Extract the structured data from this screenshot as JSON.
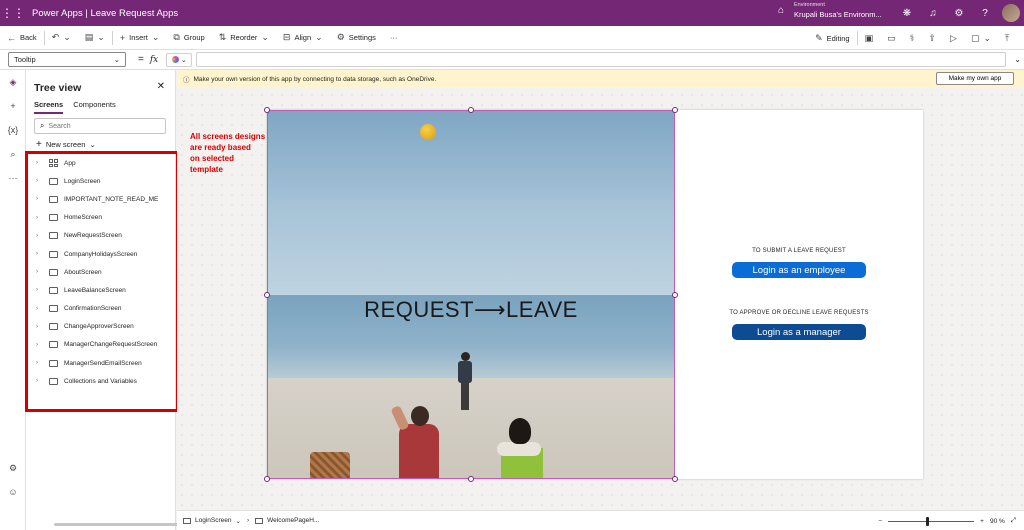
{
  "header": {
    "app_name": "Power Apps",
    "separator": "|",
    "app_title": "Leave Request Apps",
    "env_label": "Environment",
    "env_name": "Krupali Busa's Environm..."
  },
  "toolbar": {
    "back": "Back",
    "insert": "Insert",
    "group": "Group",
    "reorder": "Reorder",
    "align": "Align",
    "settings": "Settings",
    "more": "···",
    "editing": "Editing"
  },
  "formula": {
    "property": "Tooltip",
    "eq": "=",
    "fx": "fx"
  },
  "tree": {
    "title": "Tree view",
    "tabs": [
      "Screens",
      "Components"
    ],
    "search_placeholder": "Search",
    "new_screen": "New screen",
    "items": [
      "App",
      "LoginScreen",
      "IMPORTANT_NOTE_READ_ME",
      "HomeScreen",
      "NewRequestScreen",
      "CompanyHolidaysScreen",
      "AboutScreen",
      "LeaveBalanceScreen",
      "ConfirmationScreen",
      "ChangeApproverScreen",
      "ManagerChangeRequestScreen",
      "ManagerSendEmailScreen",
      "Collections and Variables"
    ]
  },
  "notice": {
    "text": "Make your own version of this app by connecting to data storage, such as OneDrive.",
    "button": "Make my own app"
  },
  "annotation": {
    "text": "All screens designs\n are ready based\non selected\ntemplate"
  },
  "screen": {
    "headline": "REQUEST⟶LEAVE",
    "employee_prompt": "TO SUBMIT A LEAVE REQUEST",
    "employee_button": "Login as an employee",
    "manager_prompt": "TO APPROVE OR DECLINE LEAVE REQUESTS",
    "manager_button": "Login as a manager"
  },
  "status": {
    "screen": "LoginScreen",
    "control": "WelcomePageH...",
    "zoom_minus": "−",
    "zoom_plus": "+",
    "zoom": "90",
    "zoom_unit": "%"
  },
  "colors": {
    "brand": "#742774",
    "employee_button": "#0b6cd8",
    "manager_button": "#0d4b92",
    "highlight": "#d40000",
    "notice_bg": "#fff4ce"
  }
}
